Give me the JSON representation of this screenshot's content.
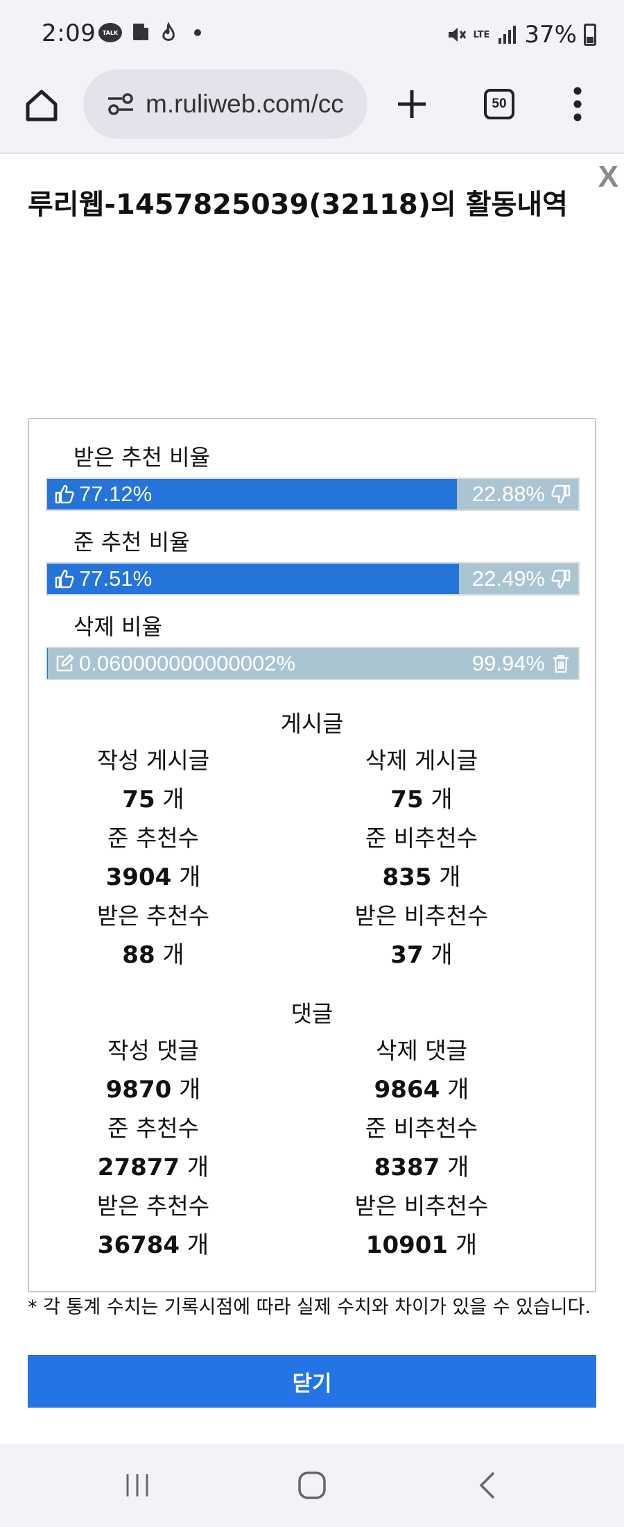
{
  "status_bar": {
    "time": "2:09",
    "talk_badge": "TALK",
    "network": "LTE",
    "battery": "37%"
  },
  "browser": {
    "url": "m.ruliweb.com/cc",
    "tab_count": "50"
  },
  "dialog": {
    "close_x": "X",
    "title": "루리웹-1457825039(32118)의 활동내역",
    "ratios": [
      {
        "label": "받은 추천 비율",
        "left_value": "77.12%",
        "right_value": "22.88%",
        "fill_percent": 77.12,
        "left_icon": "thumbs-up-icon",
        "right_icon": "thumbs-down-icon"
      },
      {
        "label": "준 추천 비율",
        "left_value": "77.51%",
        "right_value": "22.49%",
        "fill_percent": 77.51,
        "left_icon": "thumbs-up-icon",
        "right_icon": "thumbs-down-icon"
      },
      {
        "label": "삭제 비율",
        "left_value": "0.060000000000002%",
        "right_value": "99.94%",
        "fill_percent": 0.06,
        "left_icon": "edit-icon",
        "right_icon": "trash-icon"
      }
    ],
    "posts": {
      "title": "게시글",
      "unit": "개",
      "rows": [
        {
          "left_label": "작성 게시글",
          "left_value": "75",
          "right_label": "삭제 게시글",
          "right_value": "75"
        },
        {
          "left_label": "준 추천수",
          "left_value": "3904",
          "right_label": "준 비추천수",
          "right_value": "835"
        },
        {
          "left_label": "받은 추천수",
          "left_value": "88",
          "right_label": "받은 비추천수",
          "right_value": "37"
        }
      ]
    },
    "comments": {
      "title": "댓글",
      "unit": "개",
      "rows": [
        {
          "left_label": "작성 댓글",
          "left_value": "9870",
          "right_label": "삭제 댓글",
          "right_value": "9864"
        },
        {
          "left_label": "준 추천수",
          "left_value": "27877",
          "right_label": "준 비추천수",
          "right_value": "8387"
        },
        {
          "left_label": "받은 추천수",
          "left_value": "36784",
          "right_label": "받은 비추천수",
          "right_value": "10901"
        }
      ]
    },
    "note": "* 각 통계 수치는 기록시점에 따라 실제 수치와 차이가 있을 수 있습니다.",
    "close_button": "닫기"
  },
  "colors": {
    "bar_fill": "#2474d9",
    "bar_background": "#aac4d2",
    "button": "#2474e5"
  }
}
